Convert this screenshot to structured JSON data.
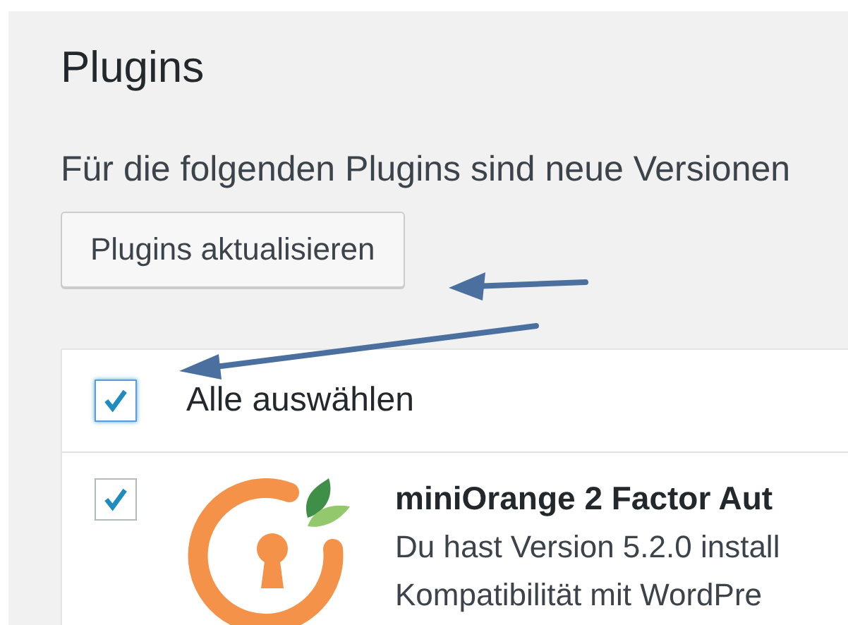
{
  "page": {
    "title": "Plugins",
    "notice": "Für die folgenden Plugins sind neue Versionen"
  },
  "update_button": {
    "label": "Plugins aktualisieren"
  },
  "select_all": {
    "label": "Alle auswählen",
    "checked": true,
    "focused": true
  },
  "plugins": [
    {
      "name": "miniOrange 2 Factor Aut",
      "description": "Du hast Version 5.2.0 install",
      "compat": "Kompatibilität mit WordPre",
      "checked": true
    }
  ]
}
